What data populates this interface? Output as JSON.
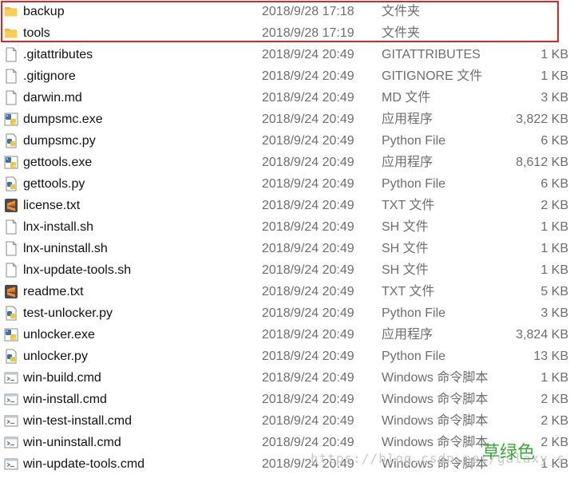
{
  "files": [
    {
      "name": "backup",
      "date": "2018/9/28 17:18",
      "type": "文件夹",
      "size": "",
      "icon": "folder-icon"
    },
    {
      "name": "tools",
      "date": "2018/9/28 17:19",
      "type": "文件夹",
      "size": "",
      "icon": "folder-icon"
    },
    {
      "name": ".gitattributes",
      "date": "2018/9/24 20:49",
      "type": "GITATTRIBUTES",
      "size": "1 KB",
      "icon": "file-icon"
    },
    {
      "name": ".gitignore",
      "date": "2018/9/24 20:49",
      "type": "GITIGNORE 文件",
      "size": "1 KB",
      "icon": "file-icon"
    },
    {
      "name": "darwin.md",
      "date": "2018/9/24 20:49",
      "type": "MD 文件",
      "size": "3 KB",
      "icon": "file-icon"
    },
    {
      "name": "dumpsmc.exe",
      "date": "2018/9/24 20:49",
      "type": "应用程序",
      "size": "3,822 KB",
      "icon": "python-exe-icon"
    },
    {
      "name": "dumpsmc.py",
      "date": "2018/9/24 20:49",
      "type": "Python File",
      "size": "6 KB",
      "icon": "python-file-icon"
    },
    {
      "name": "gettools.exe",
      "date": "2018/9/24 20:49",
      "type": "应用程序",
      "size": "8,612 KB",
      "icon": "python-exe-icon"
    },
    {
      "name": "gettools.py",
      "date": "2018/9/24 20:49",
      "type": "Python File",
      "size": "6 KB",
      "icon": "python-file-icon"
    },
    {
      "name": "license.txt",
      "date": "2018/9/24 20:49",
      "type": "TXT 文件",
      "size": "2 KB",
      "icon": "sublime-text-icon"
    },
    {
      "name": "lnx-install.sh",
      "date": "2018/9/24 20:49",
      "type": "SH 文件",
      "size": "1 KB",
      "icon": "file-icon"
    },
    {
      "name": "lnx-uninstall.sh",
      "date": "2018/9/24 20:49",
      "type": "SH 文件",
      "size": "1 KB",
      "icon": "file-icon"
    },
    {
      "name": "lnx-update-tools.sh",
      "date": "2018/9/24 20:49",
      "type": "SH 文件",
      "size": "1 KB",
      "icon": "file-icon"
    },
    {
      "name": "readme.txt",
      "date": "2018/9/24 20:49",
      "type": "TXT 文件",
      "size": "5 KB",
      "icon": "sublime-text-icon"
    },
    {
      "name": "test-unlocker.py",
      "date": "2018/9/24 20:49",
      "type": "Python File",
      "size": "3 KB",
      "icon": "python-file-icon"
    },
    {
      "name": "unlocker.exe",
      "date": "2018/9/24 20:49",
      "type": "应用程序",
      "size": "3,824 KB",
      "icon": "python-exe-icon"
    },
    {
      "name": "unlocker.py",
      "date": "2018/9/24 20:49",
      "type": "Python File",
      "size": "13 KB",
      "icon": "python-file-icon"
    },
    {
      "name": "win-build.cmd",
      "date": "2018/9/24 20:49",
      "type": "Windows 命令脚本",
      "size": "1 KB",
      "icon": "cmd-script-icon"
    },
    {
      "name": "win-install.cmd",
      "date": "2018/9/24 20:49",
      "type": "Windows 命令脚本",
      "size": "2 KB",
      "icon": "cmd-script-icon"
    },
    {
      "name": "win-test-install.cmd",
      "date": "2018/9/24 20:49",
      "type": "Windows 命令脚本",
      "size": "2 KB",
      "icon": "cmd-script-icon"
    },
    {
      "name": "win-uninstall.cmd",
      "date": "2018/9/24 20:49",
      "type": "Windows 命令脚本",
      "size": "2 KB",
      "icon": "cmd-script-icon"
    },
    {
      "name": "win-update-tools.cmd",
      "date": "2018/9/24 20:49",
      "type": "Windows 命令脚本",
      "size": "1 KB",
      "icon": "cmd-script-icon"
    }
  ],
  "watermark": "https://blog.csdn.net/galaxy_s",
  "stamp": "草绿色",
  "colors": {
    "highlight_border": "#d9262a",
    "folder": "#f5c742",
    "stamp": "#3aa83c",
    "secondary_text": "#6d6d6d"
  }
}
